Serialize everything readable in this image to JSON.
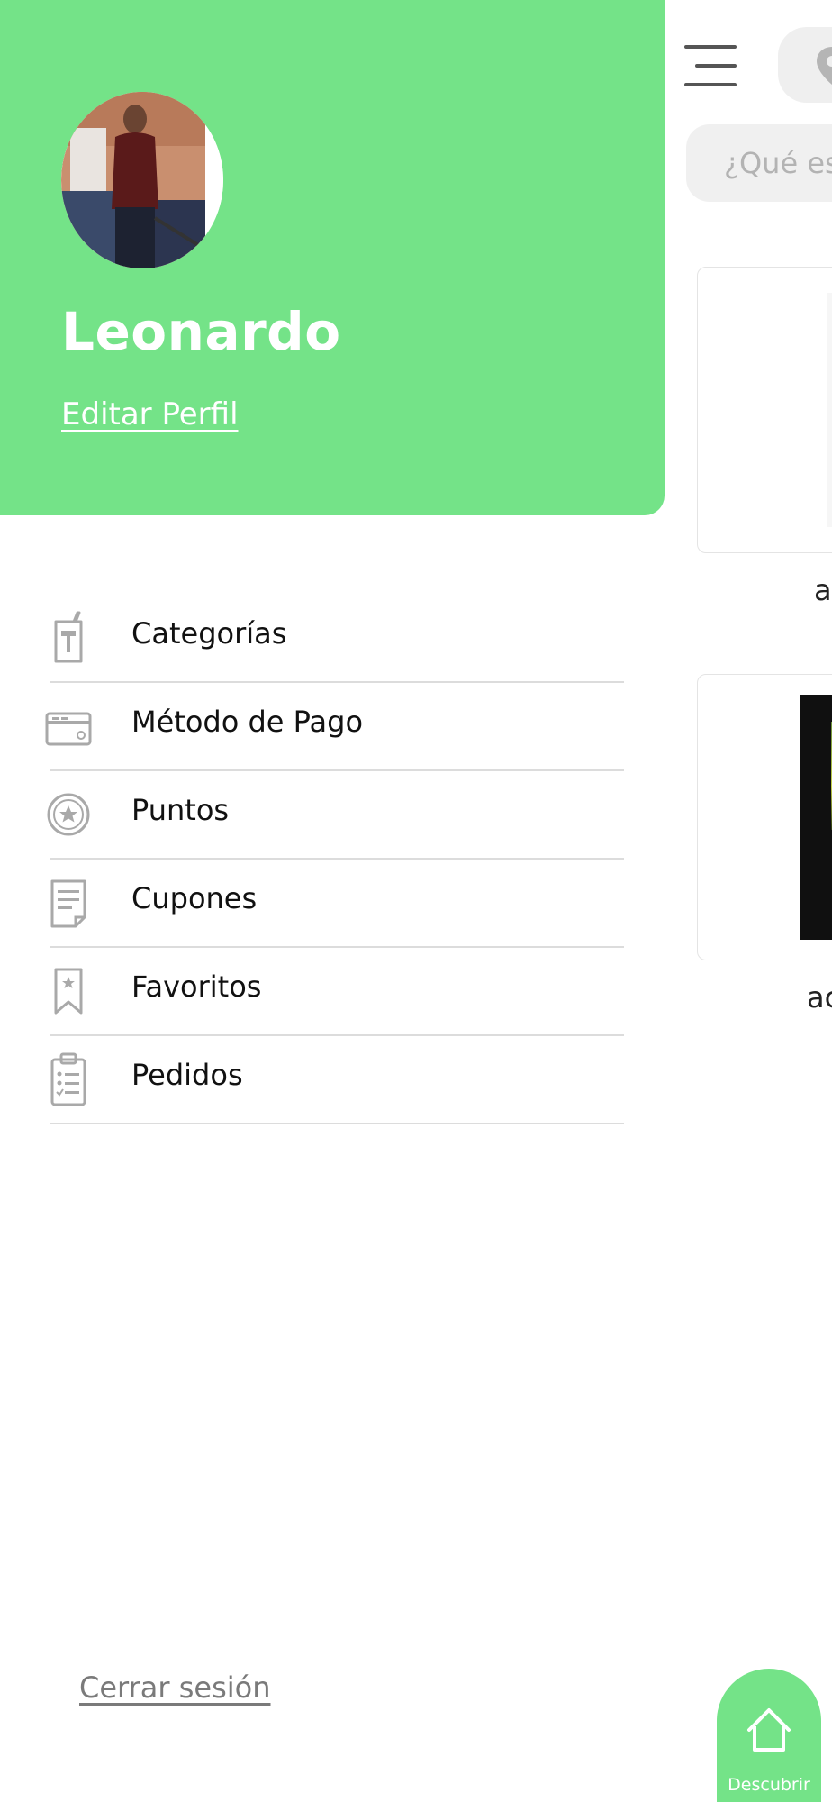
{
  "drawer": {
    "user_name": "Leonardo",
    "edit_profile_label": "Editar Perfil",
    "menu": [
      {
        "label": "Categorías",
        "icon": "drink-category-icon"
      },
      {
        "label": "Método de Pago",
        "icon": "credit-card-icon"
      },
      {
        "label": "Puntos",
        "icon": "star-badge-icon"
      },
      {
        "label": "Cupones",
        "icon": "coupon-document-icon"
      },
      {
        "label": "Favoritos",
        "icon": "bookmark-star-icon"
      },
      {
        "label": "Pedidos",
        "icon": "clipboard-list-icon"
      }
    ],
    "logout_label": "Cerrar sesión"
  },
  "background_app": {
    "search_placeholder": "¿Qué es",
    "products": [
      {
        "name": "a"
      },
      {
        "name": "ac"
      }
    ],
    "bottom_nav": {
      "discover_label": "Descubrir"
    }
  },
  "colors": {
    "accent_green": "#74e388",
    "divider": "#dcdcdc",
    "icon_gray": "#a9a9a9",
    "logout_gray": "#7a7a7a"
  }
}
